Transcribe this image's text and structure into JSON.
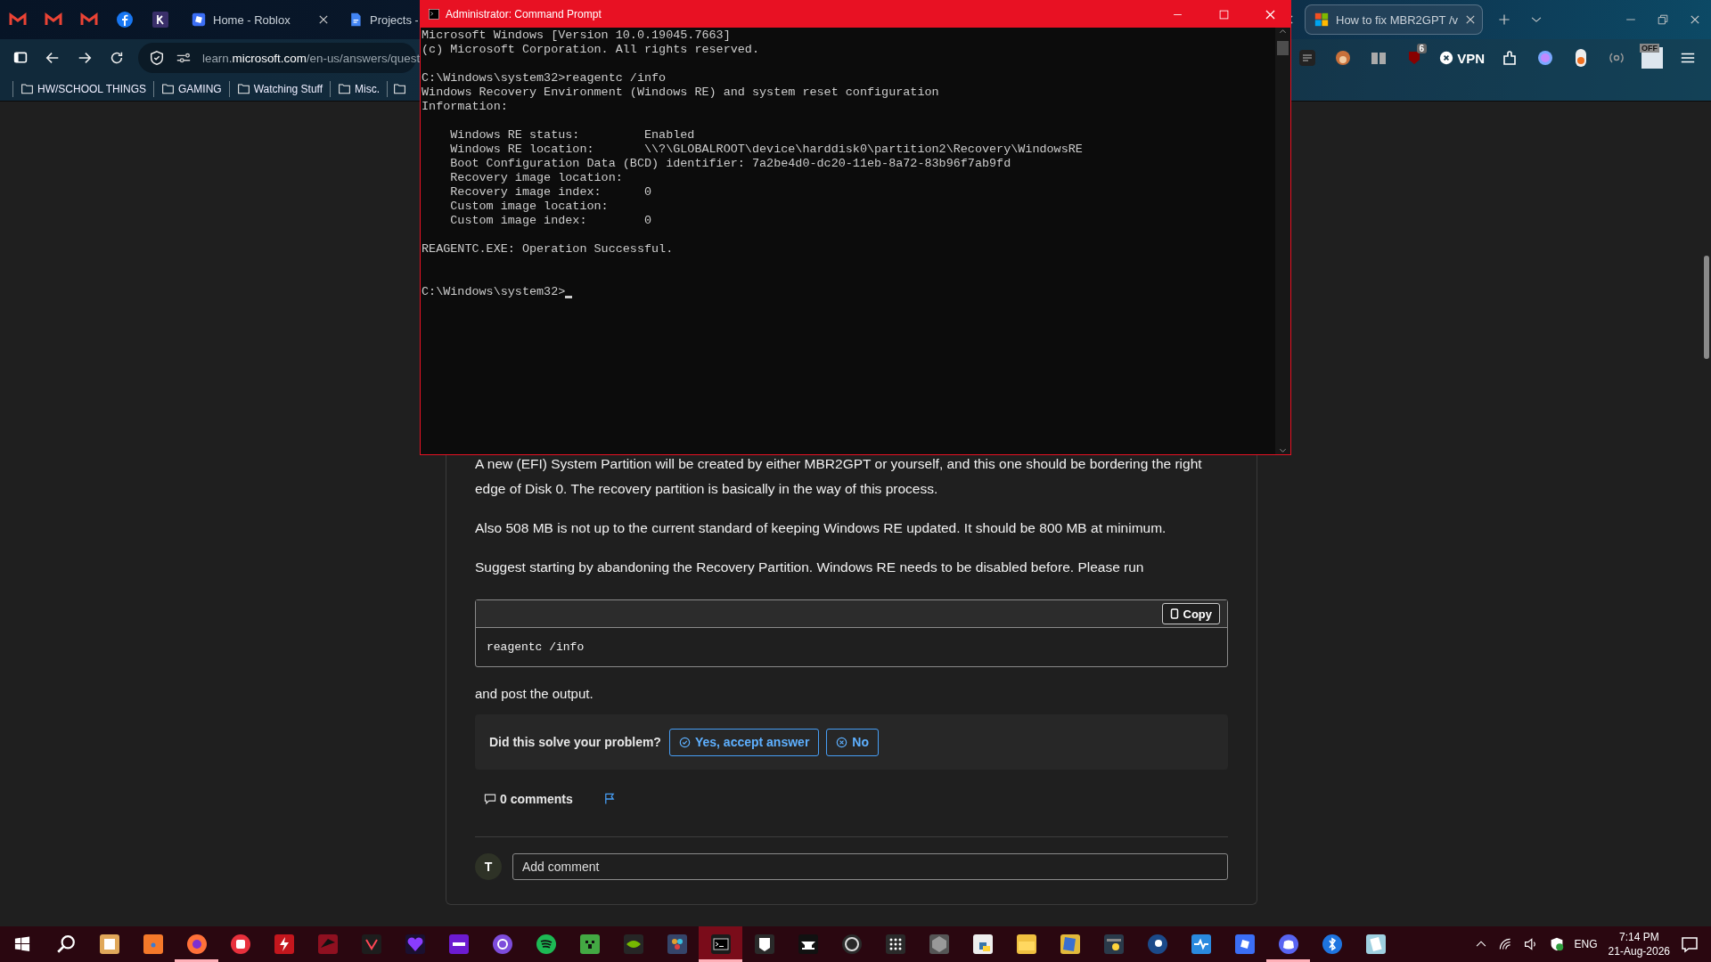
{
  "browser": {
    "tabs": [
      {
        "title": "Home - Roblox",
        "kind": "site",
        "selected": false
      },
      {
        "title": "Projects -",
        "kind": "doc",
        "selected": false
      },
      {
        "title": "How to fix MBR2GPT /v",
        "kind": "ms",
        "selected": true
      }
    ],
    "address": "learn.**microsoft.com**/en-us/answers/quest",
    "vpn_label": "VPN",
    "badge": "6",
    "off_label": "OFF",
    "bookmarks": [
      "HW/SCHOOL THINGS",
      "GAMING",
      "Watching Stuff",
      "Misc."
    ]
  },
  "console": {
    "title": "Administrator: Command Prompt",
    "blocks": [
      {
        "kind": "output",
        "lines": [
          "Microsoft Windows [Version 10.0.19045.7663]",
          "(c) Microsoft Corporation. All rights reserved."
        ]
      },
      {
        "kind": "output",
        "lines": [
          "C:\\Windows\\system32>reagentc /info",
          "Windows Recovery Environment (Windows RE) and system reset configuration",
          "Information:"
        ]
      },
      {
        "kind": "output",
        "lines": [
          "    Windows RE status:         Enabled",
          "    Windows RE location:       \\\\?\\GLOBALROOT\\device\\harddisk0\\partition2\\Recovery\\WindowsRE",
          "    Boot Configuration Data (BCD) identifier: 7a2be4d0-dc20-11eb-8a72-83b96f7ab9fd",
          "    Recovery image location:",
          "    Recovery image index:      0",
          "    Custom image location:",
          "    Custom image index:        0"
        ]
      },
      {
        "kind": "output",
        "lines": [
          "REAGENTC.EXE: Operation Successful."
        ]
      },
      {
        "kind": "prompt",
        "lines": [
          "C:\\Windows\\system32>"
        ]
      }
    ]
  },
  "article": {
    "paragraphs": [
      "A new (EFI) System Partition will be created by either MBR2GPT or yourself, and this one should be bordering the right edge of Disk 0. The recovery partition is basically in the way of this process.",
      "Also 508 MB is not up to the current standard of keeping Windows RE updated. It should be 800 MB at minimum.",
      "Suggest starting by abandoning the Recovery Partition. Windows RE needs to be disabled before. Please run"
    ],
    "code": {
      "copy_label": "Copy",
      "text": "reagentc /info"
    },
    "after_code": "and post the output.",
    "feedback": {
      "question": "Did this solve your problem?",
      "buttons": [
        {
          "label": "Yes, accept answer",
          "kind": "yes"
        },
        {
          "label": "No",
          "kind": "no"
        }
      ]
    },
    "comments": "0 comments",
    "comment_box": {
      "avatar": "T",
      "placeholder": "Add comment"
    }
  },
  "taskbar": {
    "apps": [
      {
        "kind": "photos",
        "running": false,
        "selected": false
      },
      {
        "kind": "blender",
        "running": false,
        "selected": false
      },
      {
        "kind": "firefox",
        "running": true,
        "selected": false
      },
      {
        "kind": "riot",
        "running": false,
        "selected": false
      },
      {
        "kind": "bolt",
        "running": false,
        "selected": false
      },
      {
        "kind": "dragon",
        "running": false,
        "selected": false
      },
      {
        "kind": "valorant",
        "running": false,
        "selected": false
      },
      {
        "kind": "heart",
        "running": false,
        "selected": false
      },
      {
        "kind": "nzxt",
        "running": false,
        "selected": false
      },
      {
        "kind": "tor",
        "running": false,
        "selected": false
      },
      {
        "kind": "spotify",
        "running": false,
        "selected": false
      },
      {
        "kind": "minecraft",
        "running": false,
        "selected": false
      },
      {
        "kind": "nvidia",
        "running": false,
        "selected": false
      },
      {
        "kind": "davinci",
        "running": false,
        "selected": false
      },
      {
        "kind": "terminal",
        "running": true,
        "selected": true
      },
      {
        "kind": "epic",
        "running": false,
        "selected": false
      },
      {
        "kind": "unreal",
        "running": false,
        "selected": false
      },
      {
        "kind": "obs",
        "running": false,
        "selected": false
      },
      {
        "kind": "launcher",
        "running": false,
        "selected": false
      },
      {
        "kind": "cube",
        "running": false,
        "selected": false
      },
      {
        "kind": "pydoc",
        "running": false,
        "selected": false
      },
      {
        "kind": "folder",
        "running": false,
        "selected": false
      },
      {
        "kind": "winrar",
        "running": false,
        "selected": false
      },
      {
        "kind": "pyide",
        "running": false,
        "selected": false
      },
      {
        "kind": "steam",
        "running": false,
        "selected": false
      },
      {
        "kind": "health",
        "running": false,
        "selected": false
      },
      {
        "kind": "roblox",
        "running": false,
        "selected": false
      },
      {
        "kind": "discord",
        "running": true,
        "selected": false
      },
      {
        "kind": "bluetooth",
        "running": false,
        "selected": false
      },
      {
        "kind": "notepad",
        "running": false,
        "selected": false
      }
    ],
    "language": "ENG",
    "time": "7:14 PM",
    "date": "21-Aug-2026"
  }
}
